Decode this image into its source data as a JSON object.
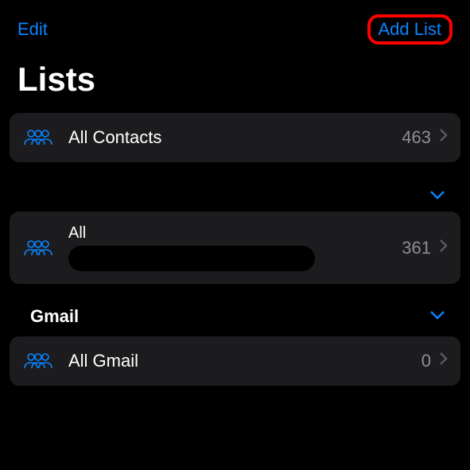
{
  "nav": {
    "edit_label": "Edit",
    "add_list_label": "Add List"
  },
  "title": "Lists",
  "rows": {
    "all_contacts": {
      "label": "All Contacts",
      "count": "463"
    },
    "all": {
      "label": "All",
      "count": "361"
    },
    "all_gmail": {
      "label": "All Gmail",
      "count": "0"
    }
  },
  "sections": {
    "gmail": {
      "title": "Gmail"
    }
  }
}
